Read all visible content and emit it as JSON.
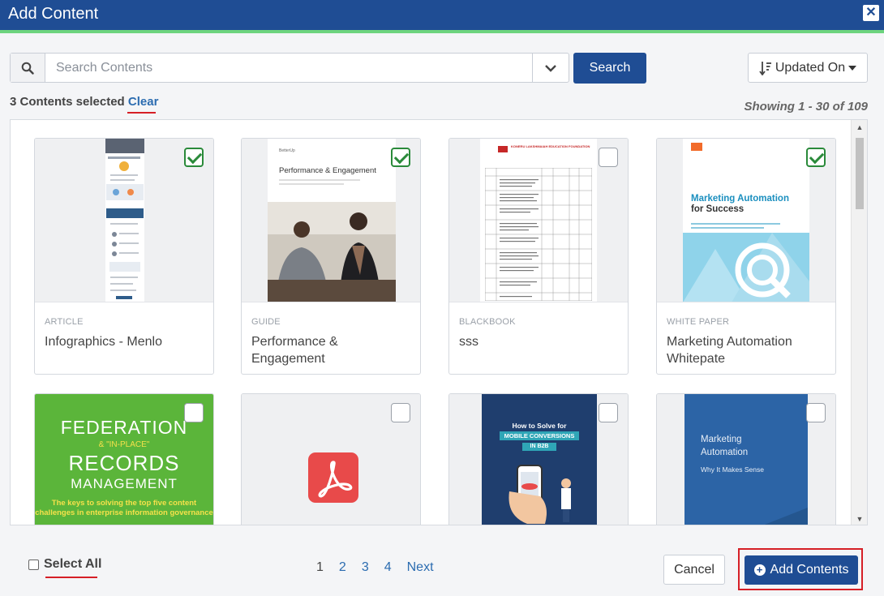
{
  "window": {
    "title": "Add Content",
    "close_glyph": "✕"
  },
  "search": {
    "placeholder": "Search Contents",
    "value": "",
    "button_label": "Search"
  },
  "sort": {
    "label": "Updated On"
  },
  "selection": {
    "count_text": "3 Contents selected",
    "clear_label": "Clear"
  },
  "showing": "Showing 1 - 30 of 109",
  "cards": [
    {
      "type": "ARTICLE",
      "name": "Infographics - Menlo",
      "checked": true
    },
    {
      "type": "GUIDE",
      "name": "Performance & Engagement",
      "checked": true,
      "thumb_title": "Performance & Engagement",
      "thumb_brand": "BetterUp"
    },
    {
      "type": "BLACKBOOK",
      "name": "sss",
      "checked": false,
      "thumb_title": "KONERU LAKSHMAIAH EDUCATION FOUNDATION"
    },
    {
      "type": "WHITE PAPER",
      "name": "Marketing Automation Whitepate",
      "checked": true,
      "thumb_title_1": "Marketing Automation",
      "thumb_title_2": "for Success"
    },
    {
      "checked": false,
      "thumb_l1": "FEDERATION",
      "thumb_l2": "& \"IN-PLACE\"",
      "thumb_l3": "RECORDS",
      "thumb_l4": "MANAGEMENT",
      "thumb_l5": "The keys to solving the top five content challenges in enterprise information governance"
    },
    {
      "checked": false,
      "thumb_icon": "pdf-icon"
    },
    {
      "checked": false,
      "thumb_l1": "How to Solve for",
      "thumb_l2": "MOBILE CONVERSIONS",
      "thumb_l3": "IN B2B"
    },
    {
      "checked": false,
      "thumb_l1": "Marketing",
      "thumb_l2": "Automation",
      "thumb_l3": "Why It Makes Sense"
    }
  ],
  "footer": {
    "select_all_label": "Select All",
    "pages": [
      "1",
      "2",
      "3",
      "4"
    ],
    "next_label": "Next",
    "cancel_label": "Cancel",
    "add_label": "Add Contents"
  },
  "colors": {
    "header": "#1f4d94",
    "accent_line": "#6dd47e",
    "link": "#2b6cb0",
    "highlight": "#d61f26",
    "check": "#2a8a3a"
  }
}
